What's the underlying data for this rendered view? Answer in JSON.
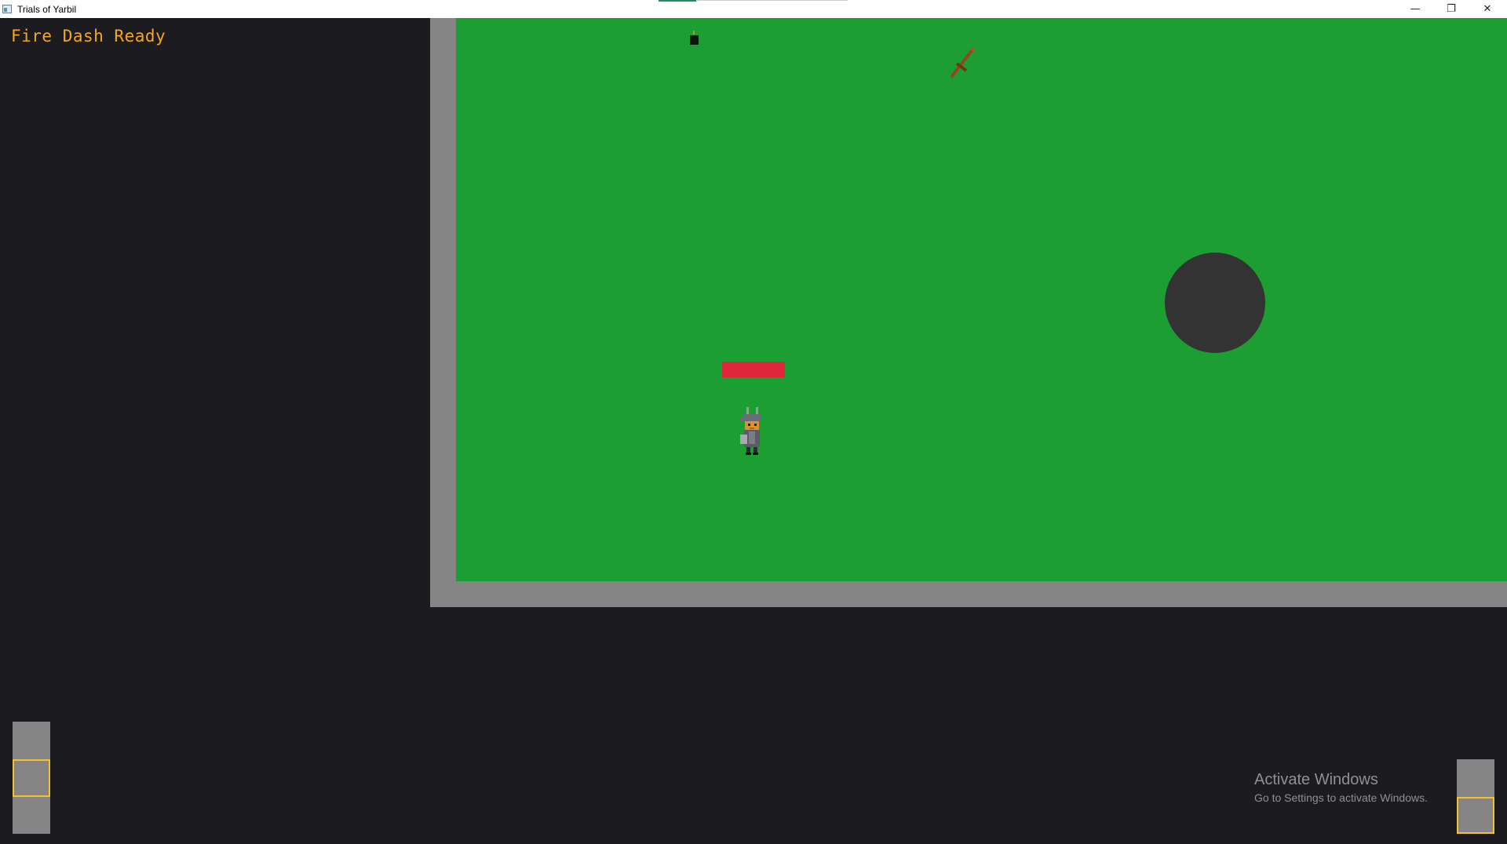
{
  "window": {
    "title": "Trials of Yarbil",
    "controls": {
      "minimize": "—",
      "maximize": "❐",
      "close": "✕"
    }
  },
  "hud": {
    "status": "Fire Dash Ready",
    "status_color": "#f5a623"
  },
  "arena": {
    "wall_color": "#858585",
    "grass_color": "#1c9e33",
    "pit_color": "#333333",
    "enemy_bar_color": "#e0263a",
    "items": [
      "bomb-icon",
      "sword-icon"
    ],
    "player": "player-sprite"
  },
  "inventory": {
    "left_slot_highlight": "#f2c230",
    "right_slot_highlight": "#f2c230"
  },
  "watermark": {
    "title": "Activate Windows",
    "subtitle": "Go to Settings to activate Windows."
  }
}
